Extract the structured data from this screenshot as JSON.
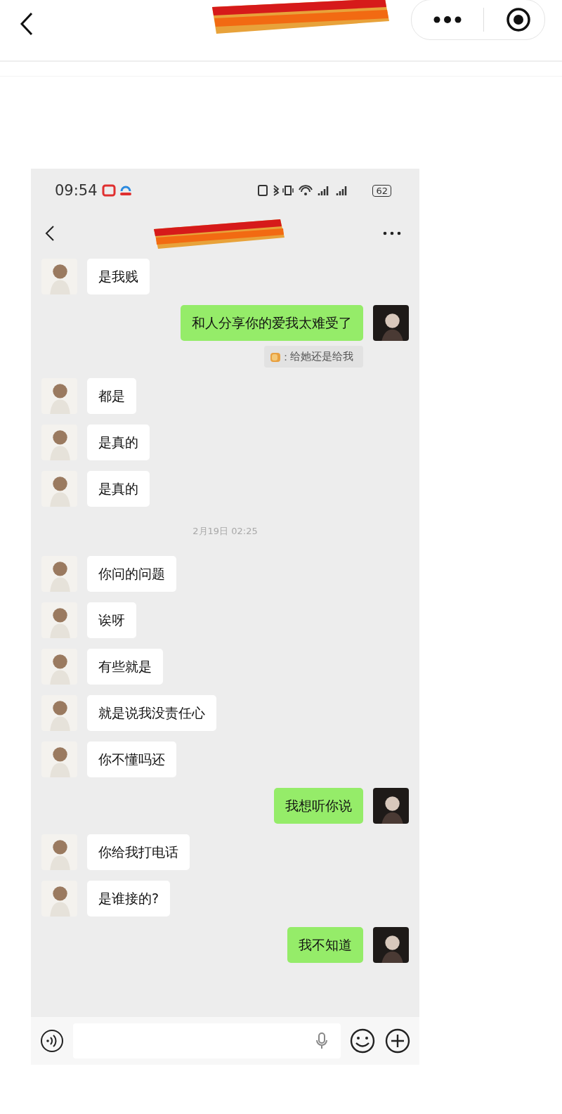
{
  "status_bar": {
    "time": "09:54",
    "battery": "62"
  },
  "messages": [
    {
      "kind": "in",
      "text": "是我贱"
    },
    {
      "kind": "out",
      "text": "和人分享你的爱我太难受了"
    },
    {
      "kind": "quote",
      "separator": ":",
      "text": "给她还是给我"
    },
    {
      "kind": "in",
      "text": "都是"
    },
    {
      "kind": "in",
      "text": "是真的"
    },
    {
      "kind": "in",
      "text": "是真的"
    },
    {
      "kind": "time",
      "text": "2月19日 02:25"
    },
    {
      "kind": "in",
      "text": "你问的问题"
    },
    {
      "kind": "in",
      "text": "诶呀"
    },
    {
      "kind": "in",
      "text": "有些就是"
    },
    {
      "kind": "in",
      "text": "就是说我没责任心"
    },
    {
      "kind": "in",
      "text": "你不懂吗还"
    },
    {
      "kind": "out",
      "text": "我想听你说"
    },
    {
      "kind": "in",
      "text": "你给我打电话"
    },
    {
      "kind": "in",
      "text": "是谁接的?"
    },
    {
      "kind": "out",
      "text": "我不知道"
    }
  ]
}
